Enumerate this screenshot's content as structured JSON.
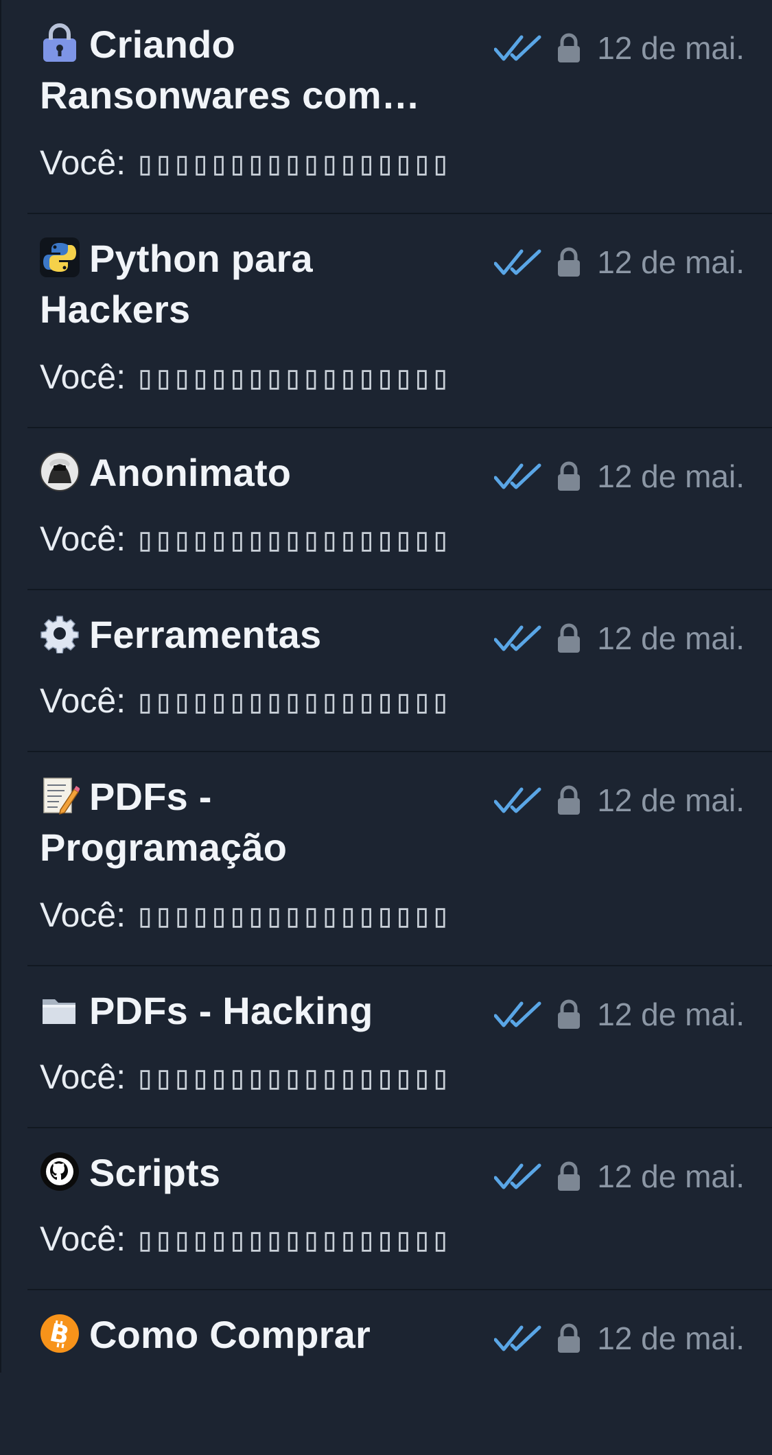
{
  "chats": [
    {
      "icon": "lock-icon",
      "title": "Criando Ransonwares com…",
      "preview_prefix": "Você:",
      "preview_text": "▯▯▯▯▯▯▯▯▯▯▯▯▯▯▯▯▯",
      "date": "12 de mai.",
      "read_status": "double-check",
      "private": true
    },
    {
      "icon": "python-icon",
      "title": "Python para Hackers",
      "preview_prefix": "Você:",
      "preview_text": "▯▯▯▯▯▯▯▯▯▯▯▯▯▯▯▯▯",
      "date": "12 de mai.",
      "read_status": "double-check",
      "private": true
    },
    {
      "icon": "anonymous-avatar-icon",
      "title": "Anonimato",
      "preview_prefix": "Você:",
      "preview_text": "▯▯▯▯▯▯▯▯▯▯▯▯▯▯▯▯▯",
      "date": "12 de mai.",
      "read_status": "double-check",
      "private": true
    },
    {
      "icon": "gear-icon",
      "title": "Ferramentas",
      "preview_prefix": "Você:",
      "preview_text": "▯▯▯▯▯▯▯▯▯▯▯▯▯▯▯▯▯",
      "date": "12 de mai.",
      "read_status": "double-check",
      "private": true
    },
    {
      "icon": "memo-icon",
      "title": "PDFs - Programação",
      "preview_prefix": "Você:",
      "preview_text": "▯▯▯▯▯▯▯▯▯▯▯▯▯▯▯▯▯",
      "date": "12 de mai.",
      "read_status": "double-check",
      "private": true
    },
    {
      "icon": "folder-icon",
      "title": "PDFs - Hacking",
      "preview_prefix": "Você:",
      "preview_text": "▯▯▯▯▯▯▯▯▯▯▯▯▯▯▯▯▯",
      "date": "12 de mai.",
      "read_status": "double-check",
      "private": true
    },
    {
      "icon": "github-icon",
      "title": "Scripts",
      "preview_prefix": "Você:",
      "preview_text": "▯▯▯▯▯▯▯▯▯▯▯▯▯▯▯▯▯",
      "date": "12 de mai.",
      "read_status": "double-check",
      "private": true
    },
    {
      "icon": "bitcoin-icon",
      "title": "Como Comprar",
      "date": "12 de mai.",
      "read_status": "double-check",
      "private": true
    }
  ],
  "colors": {
    "background": "#1c2431",
    "divider": "#111821",
    "check_blue": "#5aa6e6",
    "meta_gray": "#8c97a5",
    "lock_gray": "#7d8794"
  }
}
